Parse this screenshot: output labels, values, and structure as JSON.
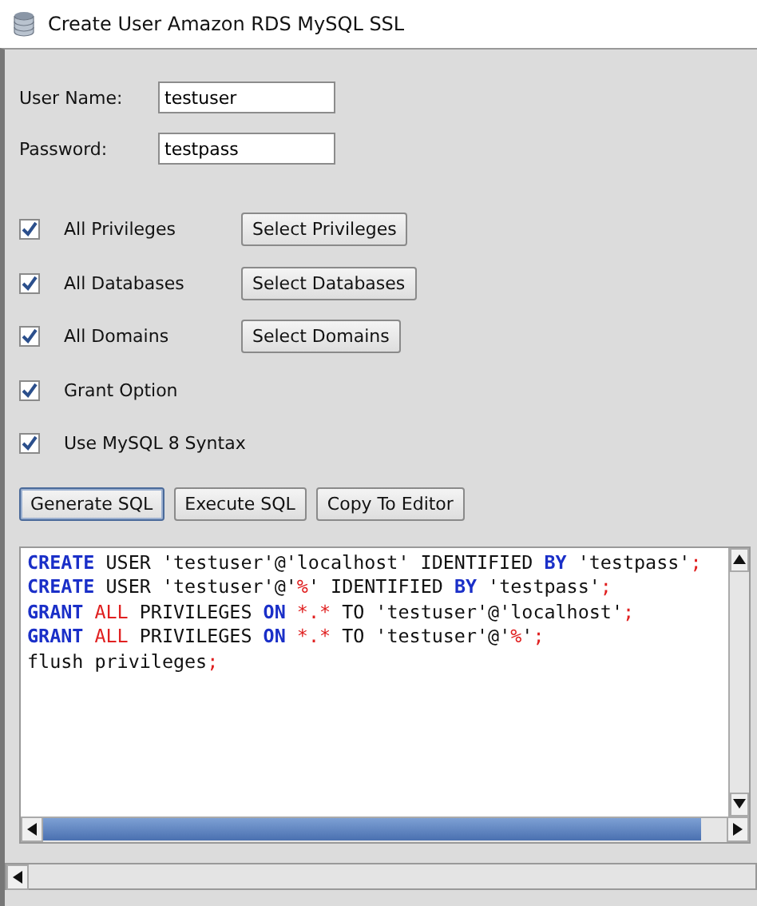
{
  "window": {
    "title": "Create User Amazon RDS MySQL SSL"
  },
  "fields": [
    {
      "label": "User Name:",
      "value": "testuser"
    },
    {
      "label": "Password:",
      "value": "testpass"
    }
  ],
  "options": [
    {
      "label": "All Privileges",
      "checked": true,
      "button": "Select Privileges"
    },
    {
      "label": "All Databases",
      "checked": true,
      "button": "Select Databases"
    },
    {
      "label": "All Domains",
      "checked": true,
      "button": "Select Domains"
    },
    {
      "label": "Grant Option",
      "checked": true
    },
    {
      "label": "Use MySQL 8 Syntax",
      "checked": true
    }
  ],
  "actions": [
    {
      "label": "Generate SQL",
      "selected": true
    },
    {
      "label": "Execute SQL",
      "selected": false
    },
    {
      "label": "Copy To Editor",
      "selected": false
    }
  ],
  "sql_lines": [
    [
      {
        "kind": "keyword",
        "text": "CREATE"
      },
      {
        "kind": "plain",
        "text": " USER 'testuser'@'localhost' IDENTIFIED "
      },
      {
        "kind": "keyword",
        "text": "BY"
      },
      {
        "kind": "plain",
        "text": " 'testpass'"
      },
      {
        "kind": "operator",
        "text": ";"
      }
    ],
    [
      {
        "kind": "keyword",
        "text": "CREATE"
      },
      {
        "kind": "plain",
        "text": " USER 'testuser'@'"
      },
      {
        "kind": "operator",
        "text": "%"
      },
      {
        "kind": "plain",
        "text": "' IDENTIFIED "
      },
      {
        "kind": "keyword",
        "text": "BY"
      },
      {
        "kind": "plain",
        "text": " 'testpass'"
      },
      {
        "kind": "operator",
        "text": ";"
      }
    ],
    [
      {
        "kind": "keyword",
        "text": "GRANT"
      },
      {
        "kind": "operator",
        "text": " ALL"
      },
      {
        "kind": "plain",
        "text": " PRIVILEGES "
      },
      {
        "kind": "keyword",
        "text": "ON"
      },
      {
        "kind": "operator",
        "text": " *.*"
      },
      {
        "kind": "plain",
        "text": " TO 'testuser'@'localhost'"
      },
      {
        "kind": "operator",
        "text": ";"
      }
    ],
    [
      {
        "kind": "keyword",
        "text": "GRANT"
      },
      {
        "kind": "operator",
        "text": " ALL"
      },
      {
        "kind": "plain",
        "text": " PRIVILEGES "
      },
      {
        "kind": "keyword",
        "text": "ON"
      },
      {
        "kind": "operator",
        "text": " *.*"
      },
      {
        "kind": "plain",
        "text": " TO 'testuser'@'"
      },
      {
        "kind": "operator",
        "text": "%"
      },
      {
        "kind": "plain",
        "text": "'"
      },
      {
        "kind": "operator",
        "text": ";"
      }
    ],
    [
      {
        "kind": "plain",
        "text": "flush privileges"
      },
      {
        "kind": "operator",
        "text": ";"
      }
    ]
  ]
}
